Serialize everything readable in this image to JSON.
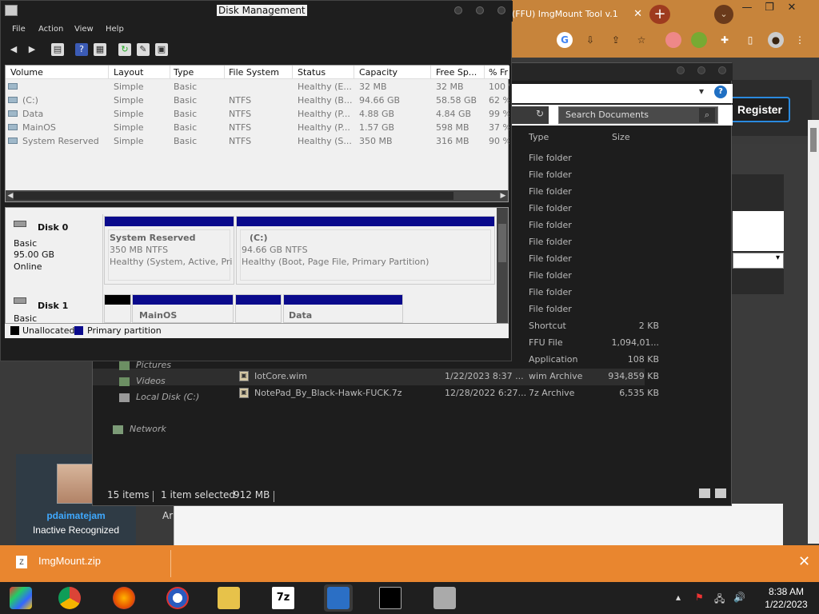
{
  "chrome": {
    "tab_title": "(FFU) ImgMount Tool v.1",
    "new_tab_label": "+",
    "window_controls": [
      "—",
      "❐",
      "✕"
    ]
  },
  "forum": {
    "register_label": "Register",
    "username": "pdaimatejam",
    "user_status": "Inactive Recognized",
    "side_tab": "Ar"
  },
  "download": {
    "filename": "ImgMount.zip",
    "close": "✕"
  },
  "explorer": {
    "search_placeholder": "Search Documents",
    "columns": {
      "type": "Type",
      "size": "Size"
    },
    "rows": [
      {
        "type": "File folder",
        "size": ""
      },
      {
        "type": "File folder",
        "size": ""
      },
      {
        "type": "File folder",
        "size": ""
      },
      {
        "type": "File folder",
        "size": ""
      },
      {
        "type": "File folder",
        "size": ""
      },
      {
        "type": "File folder",
        "size": ""
      },
      {
        "type": "File folder",
        "size": ""
      },
      {
        "type": "File folder",
        "size": ""
      },
      {
        "type": "File folder",
        "size": ""
      },
      {
        "type": "File folder",
        "size": ""
      },
      {
        "type": "Shortcut",
        "size": "2 KB"
      },
      {
        "type": "FFU File",
        "size": "1,094,01..."
      },
      {
        "type": "Application",
        "size": "108 KB"
      }
    ],
    "files": [
      {
        "name": "IotCore.wim",
        "date": "1/22/2023 8:37 ...",
        "type": "wim Archive",
        "size": "934,859 KB"
      },
      {
        "name": "NotePad_By_Black-Hawk-FUCK.7z",
        "date": "12/28/2022 6:27...",
        "type": "7z Archive",
        "size": "6,535 KB"
      }
    ],
    "nav": [
      "Pictures",
      "Videos",
      "Local Disk (C:)",
      "Network"
    ],
    "status": {
      "items": "15 items",
      "selected": "1 item selected",
      "size": "912 MB"
    }
  },
  "disk_mgmt": {
    "title": "Disk Management",
    "menu": [
      "File",
      "Action",
      "View",
      "Help"
    ],
    "columns": [
      "Volume",
      "Layout",
      "Type",
      "File System",
      "Status",
      "Capacity",
      "Free Sp...",
      "% Fr"
    ],
    "volumes": [
      {
        "volume": "",
        "layout": "Simple",
        "type": "Basic",
        "fs": "",
        "status": "Healthy (E...",
        "capacity": "32 MB",
        "free": "32 MB",
        "pct": "100 %"
      },
      {
        "volume": "(C:)",
        "layout": "Simple",
        "type": "Basic",
        "fs": "NTFS",
        "status": "Healthy (B...",
        "capacity": "94.66 GB",
        "free": "58.58 GB",
        "pct": "62 %"
      },
      {
        "volume": "Data",
        "layout": "Simple",
        "type": "Basic",
        "fs": "NTFS",
        "status": "Healthy (P...",
        "capacity": "4.88 GB",
        "free": "4.84 GB",
        "pct": "99 %"
      },
      {
        "volume": "MainOS",
        "layout": "Simple",
        "type": "Basic",
        "fs": "NTFS",
        "status": "Healthy (P...",
        "capacity": "1.57 GB",
        "free": "598 MB",
        "pct": "37 %"
      },
      {
        "volume": "System Reserved",
        "layout": "Simple",
        "type": "Basic",
        "fs": "NTFS",
        "status": "Healthy (S...",
        "capacity": "350 MB",
        "free": "316 MB",
        "pct": "90 %"
      }
    ],
    "disk0": {
      "name": "Disk 0",
      "kind": "Basic",
      "size": "95.00 GB",
      "state": "Online",
      "partitions": [
        {
          "name": "System Reserved",
          "size": "350 MB NTFS",
          "status": "Healthy (System, Active, Primary Partition)"
        },
        {
          "name": "(C:)",
          "size": "94.66 GB NTFS",
          "status": "Healthy (Boot, Page File, Primary Partition)"
        }
      ]
    },
    "disk1": {
      "name": "Disk 1",
      "kind": "Basic",
      "partitions": [
        {
          "name": "MainOS"
        },
        {
          "name": "Data"
        }
      ]
    },
    "legend": {
      "unallocated": "Unallocated",
      "primary": "Primary partition",
      "unallocated_color": "#000000",
      "primary_color": "#0a0a8c"
    }
  },
  "taskbar": {
    "time": "8:38 AM",
    "date": "1/22/2023",
    "apps": [
      "winrar-icon",
      "chrome-icon",
      "firefox-icon",
      "browser-icon",
      "file-explorer-icon",
      "7zip-icon",
      "control-panel-icon",
      "cmd-icon",
      "disk-manager-icon"
    ]
  }
}
